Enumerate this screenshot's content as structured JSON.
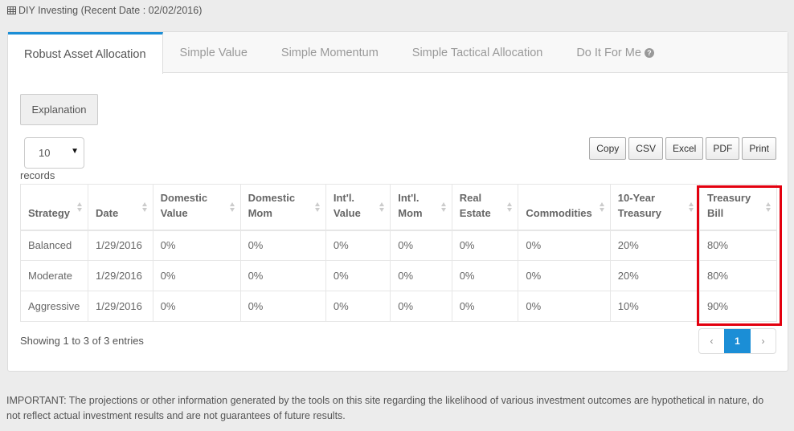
{
  "header": {
    "icon": "table-grid-icon",
    "title": "DIY Investing (Recent Date : 02/02/2016)"
  },
  "tabs": [
    {
      "label": "Robust Asset Allocation",
      "active": true
    },
    {
      "label": "Simple Value",
      "active": false
    },
    {
      "label": "Simple Momentum",
      "active": false
    },
    {
      "label": "Simple Tactical Allocation",
      "active": false
    },
    {
      "label": "Do It For Me",
      "active": false,
      "icon": "question-circle-icon"
    }
  ],
  "controls": {
    "explanation_label": "Explanation",
    "page_length_value": "10",
    "records_label": "records",
    "export_buttons": [
      "Copy",
      "CSV",
      "Excel",
      "PDF",
      "Print"
    ]
  },
  "table": {
    "columns": [
      {
        "line1": "",
        "line2": "Strategy"
      },
      {
        "line1": "",
        "line2": "Date"
      },
      {
        "line1": "Domestic",
        "line2": "Value"
      },
      {
        "line1": "Domestic",
        "line2": "Mom"
      },
      {
        "line1": "Int'l.",
        "line2": "Value"
      },
      {
        "line1": "Int'l.",
        "line2": "Mom"
      },
      {
        "line1": "Real",
        "line2": "Estate"
      },
      {
        "line1": "",
        "line2": "Commodities"
      },
      {
        "line1": "10-Year",
        "line2": "Treasury"
      },
      {
        "line1": "Treasury",
        "line2": "Bill"
      }
    ],
    "rows": [
      [
        "Balanced",
        "1/29/2016",
        "0%",
        "0%",
        "0%",
        "0%",
        "0%",
        "0%",
        "20%",
        "80%"
      ],
      [
        "Moderate",
        "1/29/2016",
        "0%",
        "0%",
        "0%",
        "0%",
        "0%",
        "0%",
        "20%",
        "80%"
      ],
      [
        "Aggressive",
        "1/29/2016",
        "0%",
        "0%",
        "0%",
        "0%",
        "0%",
        "0%",
        "10%",
        "90%"
      ]
    ],
    "highlighted_column": "Treasury Bill"
  },
  "footer": {
    "info": "Showing 1 to 3 of 3 entries",
    "pagination": {
      "prev": "‹",
      "current": "1",
      "next": "›"
    }
  },
  "disclaimer": "IMPORTANT: The projections or other information generated by the tools on this site regarding the likelihood of various investment outcomes are hypothetical in nature, do not reflect actual investment results and are not guarantees of future results.",
  "colors": {
    "accent": "#1b8ed6",
    "highlight": "#e3000f",
    "background": "#ececec"
  }
}
